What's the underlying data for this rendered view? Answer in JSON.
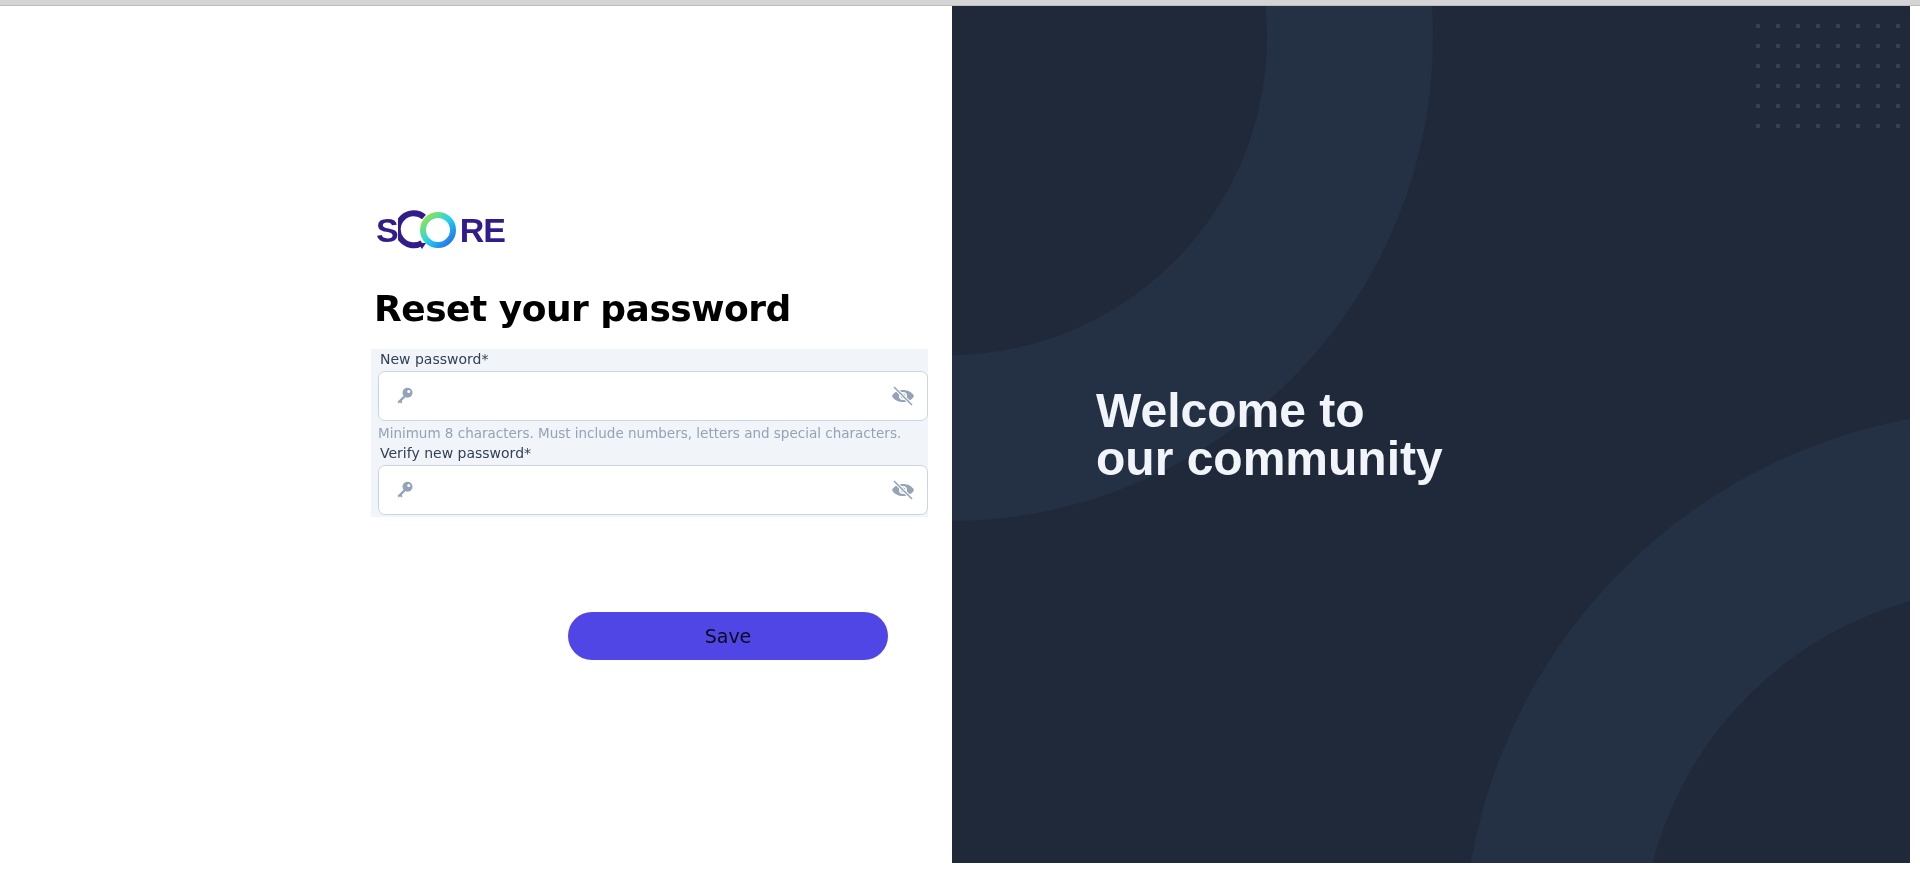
{
  "logo": {
    "prefix": "S",
    "suffix": "RE"
  },
  "title": "Reset your password",
  "fields": [
    {
      "label": "New password*",
      "hint": "Minimum 8 characters. Must include numbers, letters and special characters."
    },
    {
      "label": "Verify new password*"
    }
  ],
  "save_button": "Save",
  "welcome": {
    "line_1": "Welcome to",
    "line_2": "our community"
  }
}
